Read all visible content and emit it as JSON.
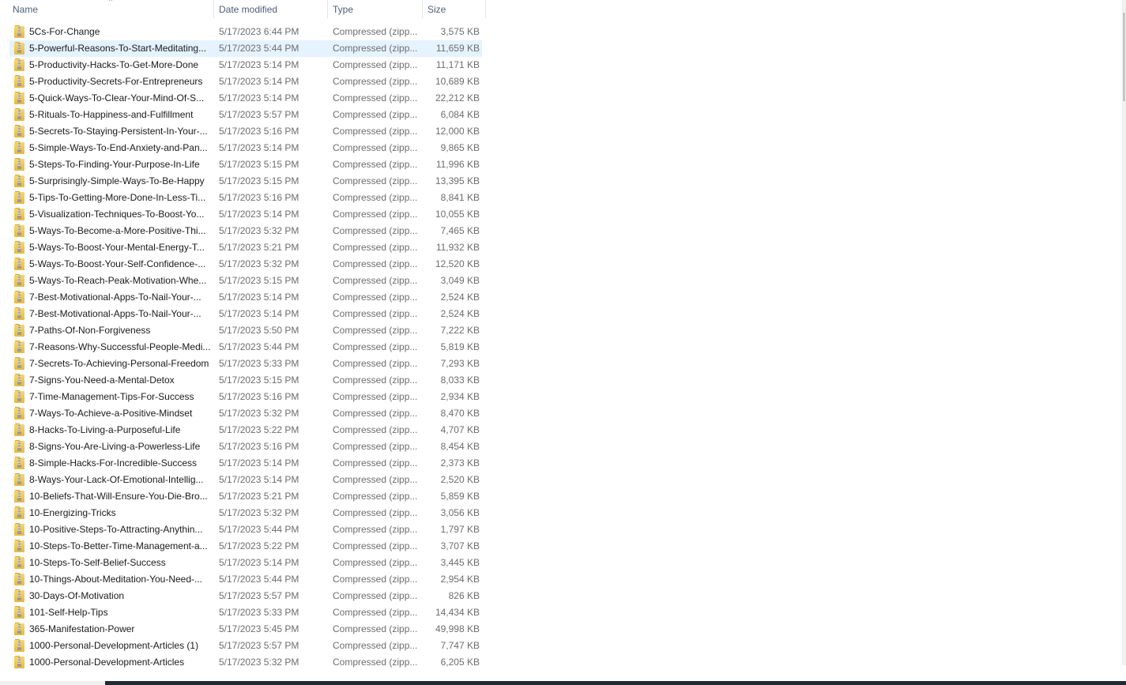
{
  "columns": {
    "name": "Name",
    "date": "Date modified",
    "type": "Type",
    "size": "Size",
    "sort_indicator": "^"
  },
  "selected_index": 1,
  "files": [
    {
      "name": "5Cs-For-Change",
      "date": "5/17/2023 6:44 PM",
      "type": "Compressed (zipp...",
      "size": "3,575 KB"
    },
    {
      "name": "5-Powerful-Reasons-To-Start-Meditating...",
      "date": "5/17/2023 5:44 PM",
      "type": "Compressed (zipp...",
      "size": "11,659 KB"
    },
    {
      "name": "5-Productivity-Hacks-To-Get-More-Done",
      "date": "5/17/2023 5:14 PM",
      "type": "Compressed (zipp...",
      "size": "11,171 KB"
    },
    {
      "name": "5-Productivity-Secrets-For-Entrepreneurs",
      "date": "5/17/2023 5:14 PM",
      "type": "Compressed (zipp...",
      "size": "10,689 KB"
    },
    {
      "name": "5-Quick-Ways-To-Clear-Your-Mind-Of-S...",
      "date": "5/17/2023 5:14 PM",
      "type": "Compressed (zipp...",
      "size": "22,212 KB"
    },
    {
      "name": "5-Rituals-To-Happiness-and-Fulfillment",
      "date": "5/17/2023 5:57 PM",
      "type": "Compressed (zipp...",
      "size": "6,084 KB"
    },
    {
      "name": "5-Secrets-To-Staying-Persistent-In-Your-...",
      "date": "5/17/2023 5:16 PM",
      "type": "Compressed (zipp...",
      "size": "12,000 KB"
    },
    {
      "name": "5-Simple-Ways-To-End-Anxiety-and-Pan...",
      "date": "5/17/2023 5:14 PM",
      "type": "Compressed (zipp...",
      "size": "9,865 KB"
    },
    {
      "name": "5-Steps-To-Finding-Your-Purpose-In-Life",
      "date": "5/17/2023 5:15 PM",
      "type": "Compressed (zipp...",
      "size": "11,996 KB"
    },
    {
      "name": "5-Surprisingly-Simple-Ways-To-Be-Happy",
      "date": "5/17/2023 5:15 PM",
      "type": "Compressed (zipp...",
      "size": "13,395 KB"
    },
    {
      "name": "5-Tips-To-Getting-More-Done-In-Less-Ti...",
      "date": "5/17/2023 5:16 PM",
      "type": "Compressed (zipp...",
      "size": "8,841 KB"
    },
    {
      "name": "5-Visualization-Techniques-To-Boost-Yo...",
      "date": "5/17/2023 5:14 PM",
      "type": "Compressed (zipp...",
      "size": "10,055 KB"
    },
    {
      "name": "5-Ways-To-Become-a-More-Positive-Thi...",
      "date": "5/17/2023 5:32 PM",
      "type": "Compressed (zipp...",
      "size": "7,465 KB"
    },
    {
      "name": "5-Ways-To-Boost-Your-Mental-Energy-T...",
      "date": "5/17/2023 5:21 PM",
      "type": "Compressed (zipp...",
      "size": "11,932 KB"
    },
    {
      "name": "5-Ways-To-Boost-Your-Self-Confidence-...",
      "date": "5/17/2023 5:32 PM",
      "type": "Compressed (zipp...",
      "size": "12,520 KB"
    },
    {
      "name": "5-Ways-To-Reach-Peak-Motivation-Whe...",
      "date": "5/17/2023 5:15 PM",
      "type": "Compressed (zipp...",
      "size": "3,049 KB"
    },
    {
      "name": "7-Best-Motivational-Apps-To-Nail-Your-...",
      "date": "5/17/2023 5:14 PM",
      "type": "Compressed (zipp...",
      "size": "2,524 KB"
    },
    {
      "name": "7-Best-Motivational-Apps-To-Nail-Your-...",
      "date": "5/17/2023 5:14 PM",
      "type": "Compressed (zipp...",
      "size": "2,524 KB"
    },
    {
      "name": "7-Paths-Of-Non-Forgiveness",
      "date": "5/17/2023 5:50 PM",
      "type": "Compressed (zipp...",
      "size": "7,222 KB"
    },
    {
      "name": "7-Reasons-Why-Successful-People-Medi...",
      "date": "5/17/2023 5:44 PM",
      "type": "Compressed (zipp...",
      "size": "5,819 KB"
    },
    {
      "name": "7-Secrets-To-Achieving-Personal-Freedom",
      "date": "5/17/2023 5:33 PM",
      "type": "Compressed (zipp...",
      "size": "7,293 KB"
    },
    {
      "name": "7-Signs-You-Need-a-Mental-Detox",
      "date": "5/17/2023 5:15 PM",
      "type": "Compressed (zipp...",
      "size": "8,033 KB"
    },
    {
      "name": "7-Time-Management-Tips-For-Success",
      "date": "5/17/2023 5:16 PM",
      "type": "Compressed (zipp...",
      "size": "2,934 KB"
    },
    {
      "name": "7-Ways-To-Achieve-a-Positive-Mindset",
      "date": "5/17/2023 5:32 PM",
      "type": "Compressed (zipp...",
      "size": "8,470 KB"
    },
    {
      "name": "8-Hacks-To-Living-a-Purposeful-Life",
      "date": "5/17/2023 5:22 PM",
      "type": "Compressed (zipp...",
      "size": "4,707 KB"
    },
    {
      "name": "8-Signs-You-Are-Living-a-Powerless-Life",
      "date": "5/17/2023 5:16 PM",
      "type": "Compressed (zipp...",
      "size": "8,454 KB"
    },
    {
      "name": "8-Simple-Hacks-For-Incredible-Success",
      "date": "5/17/2023 5:14 PM",
      "type": "Compressed (zipp...",
      "size": "2,373 KB"
    },
    {
      "name": "8-Ways-Your-Lack-Of-Emotional-Intellig...",
      "date": "5/17/2023 5:14 PM",
      "type": "Compressed (zipp...",
      "size": "2,520 KB"
    },
    {
      "name": "10-Beliefs-That-Will-Ensure-You-Die-Bro...",
      "date": "5/17/2023 5:21 PM",
      "type": "Compressed (zipp...",
      "size": "5,859 KB"
    },
    {
      "name": "10-Energizing-Tricks",
      "date": "5/17/2023 5:32 PM",
      "type": "Compressed (zipp...",
      "size": "3,056 KB"
    },
    {
      "name": "10-Positive-Steps-To-Attracting-Anythin...",
      "date": "5/17/2023 5:44 PM",
      "type": "Compressed (zipp...",
      "size": "1,797 KB"
    },
    {
      "name": "10-Steps-To-Better-Time-Management-a...",
      "date": "5/17/2023 5:22 PM",
      "type": "Compressed (zipp...",
      "size": "3,707 KB"
    },
    {
      "name": "10-Steps-To-Self-Belief-Success",
      "date": "5/17/2023 5:14 PM",
      "type": "Compressed (zipp...",
      "size": "3,445 KB"
    },
    {
      "name": "10-Things-About-Meditation-You-Need-...",
      "date": "5/17/2023 5:44 PM",
      "type": "Compressed (zipp...",
      "size": "2,954 KB"
    },
    {
      "name": "30-Days-Of-Motivation",
      "date": "5/17/2023 5:57 PM",
      "type": "Compressed (zipp...",
      "size": "826 KB"
    },
    {
      "name": "101-Self-Help-Tips",
      "date": "5/17/2023 5:33 PM",
      "type": "Compressed (zipp...",
      "size": "14,434 KB"
    },
    {
      "name": "365-Manifestation-Power",
      "date": "5/17/2023 5:45 PM",
      "type": "Compressed (zipp...",
      "size": "49,998 KB"
    },
    {
      "name": "1000-Personal-Development-Articles (1)",
      "date": "5/17/2023 5:57 PM",
      "type": "Compressed (zipp...",
      "size": "7,747 KB"
    },
    {
      "name": "1000-Personal-Development-Articles",
      "date": "5/17/2023 5:32 PM",
      "type": "Compressed (zipp...",
      "size": "6,205 KB"
    }
  ],
  "colors": {
    "selection": "#e5f3ff",
    "header_text": "#4c607a",
    "secondary_text": "#6d6d6d"
  }
}
